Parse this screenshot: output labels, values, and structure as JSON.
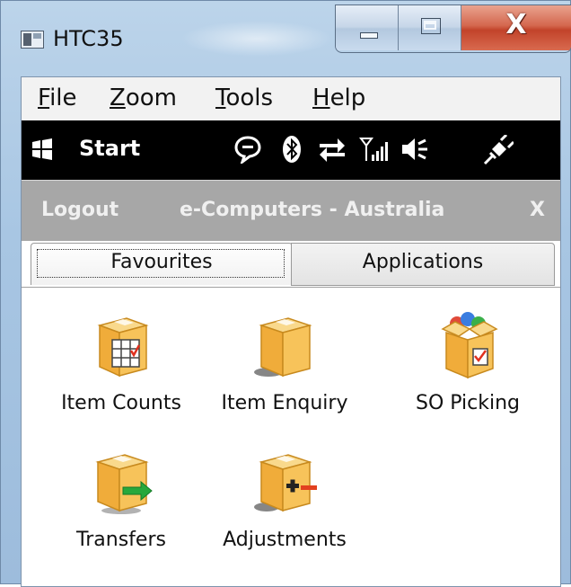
{
  "window": {
    "title": "HTC35",
    "close_glyph": "X",
    "icons": [
      "app-icon",
      "minimize-icon",
      "maximize-icon",
      "close-icon"
    ]
  },
  "menubar": {
    "items": [
      {
        "label": "File",
        "mnemonic": "F",
        "rest": "ile"
      },
      {
        "label": "Zoom",
        "mnemonic": "Z",
        "rest": "oom"
      },
      {
        "label": "Tools",
        "mnemonic": "T",
        "rest": "ools"
      },
      {
        "label": "Help",
        "mnemonic": "H",
        "rest": "elp"
      }
    ]
  },
  "taskbar": {
    "start_label": "Start",
    "icons": [
      "windows-flag-icon",
      "messaging-icon",
      "bluetooth-icon",
      "sync-arrows-icon",
      "signal-strength-icon",
      "speaker-icon",
      "power-plug-icon"
    ]
  },
  "status_bar": {
    "logout": "Logout",
    "company": "e-Computers - Australia",
    "close": "X"
  },
  "tabs": [
    {
      "label": "Favourites",
      "selected": true
    },
    {
      "label": "Applications",
      "selected": false
    }
  ],
  "apps": [
    {
      "label": "Item Counts",
      "icon": "item-counts-box-icon"
    },
    {
      "label": "Item Enquiry",
      "icon": "item-enquiry-box-icon"
    },
    {
      "label": "SO Picking",
      "icon": "so-picking-box-icon"
    },
    {
      "label": "Transfers",
      "icon": "transfers-box-icon"
    },
    {
      "label": "Adjustments",
      "icon": "adjustments-box-icon"
    }
  ],
  "colors": {
    "taskbar_bg": "#000000",
    "status_bar_bg": "#a7a7a7",
    "close_button": "#c94a30",
    "box": "#f2b84b",
    "arrow_green": "#27a83c",
    "minus_red": "#e2401f"
  }
}
